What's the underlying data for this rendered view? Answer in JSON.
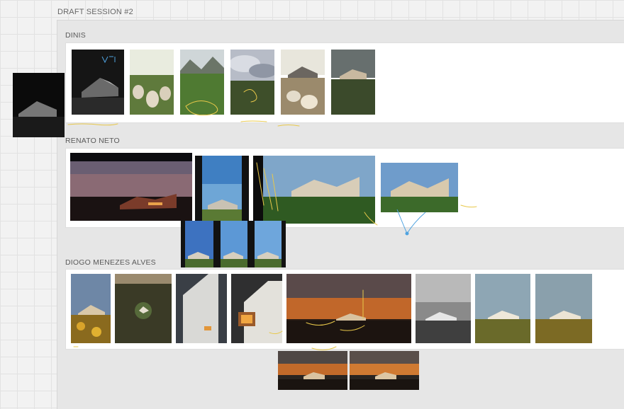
{
  "session": {
    "title": "DRAFT SESSION #2"
  },
  "sections": [
    {
      "name": "DINIS"
    },
    {
      "name": "RENATO NETO"
    },
    {
      "name": "DIOGO MENEZES ALVES"
    }
  ],
  "colors": {
    "annotation": "#e8c84a",
    "annotation_blue": "#4fa3e0",
    "board": "#ffffff",
    "panel": "#e6e6e6",
    "canvas": "#f2f2f2"
  },
  "icons": [
    "connector-node-icon"
  ]
}
